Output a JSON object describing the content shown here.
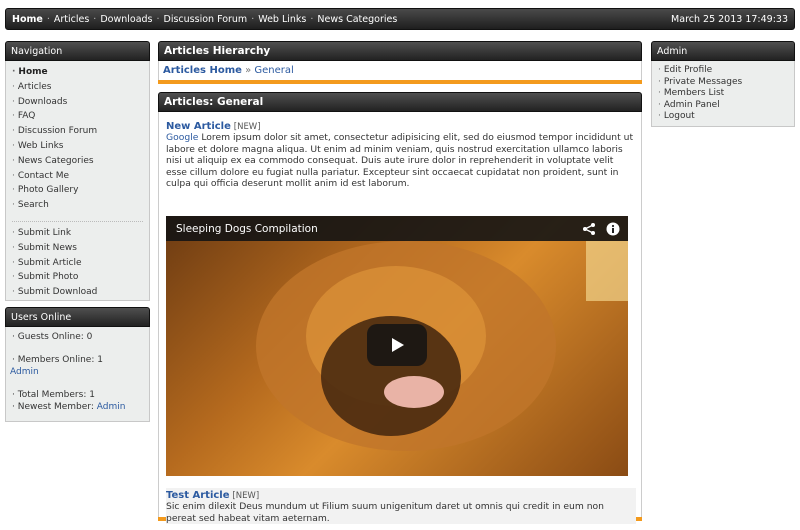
{
  "topbar": {
    "links": [
      "Home",
      "Articles",
      "Downloads",
      "Discussion Forum",
      "Web Links",
      "News Categories"
    ],
    "datetime": "March 25 2013 17:49:33"
  },
  "navigation": {
    "title": "Navigation",
    "items": [
      "Home",
      "Articles",
      "Downloads",
      "FAQ",
      "Discussion Forum",
      "Web Links",
      "News Categories",
      "Contact Me",
      "Photo Gallery",
      "Search"
    ],
    "submit_items": [
      "Submit Link",
      "Submit News",
      "Submit Article",
      "Submit Photo",
      "Submit Download"
    ]
  },
  "users_online": {
    "title": "Users Online",
    "guests": "Guests Online: 0",
    "members": "Members Online: 1",
    "member_name": "Admin",
    "total": "Total Members: 1",
    "newest_label": "Newest Member:",
    "newest_name": "Admin"
  },
  "admin": {
    "title": "Admin",
    "items": [
      "Edit Profile",
      "Private Messages",
      "Members List",
      "Admin Panel",
      "Logout"
    ]
  },
  "hierarchy": {
    "title": "Articles Hierarchy",
    "home": "Articles Home",
    "sep": "»",
    "current": "General"
  },
  "articles": {
    "title": "Articles: General",
    "items": [
      {
        "title": "New Article",
        "tag": "[NEW]",
        "link": "Google",
        "text": "Lorem ipsum dolor sit amet, consectetur adipisicing elit, sed do eiusmod tempor incididunt ut labore et dolore magna aliqua. Ut enim ad minim veniam, quis nostrud exercitation ullamco laboris nisi ut aliquip ex ea commodo consequat. Duis aute irure dolor in reprehenderit in voluptate velit esse cillum dolore eu fugiat nulla pariatur. Excepteur sint occaecat cupidatat non proident, sunt in culpa qui officia deserunt mollit anim id est laborum."
      },
      {
        "title": "Test Article",
        "tag": "[NEW]",
        "text": "Sic enim dilexit Deus mundum ut Filium suum unigenitum daret ut omnis qui credit in eum non pereat sed habeat vitam aeternam."
      }
    ]
  },
  "video": {
    "title": "Sleeping Dogs Compilation",
    "icons": [
      "share-icon",
      "info-icon",
      "play-icon"
    ]
  }
}
